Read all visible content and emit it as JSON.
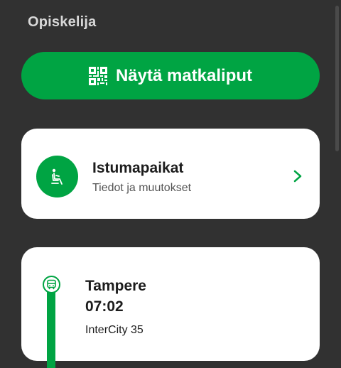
{
  "header": {
    "user_type": "Opiskelija"
  },
  "tickets_button": {
    "icon": "qr-code-icon",
    "label": "Näytä matkaliput"
  },
  "seats_card": {
    "icon": "seat-icon",
    "title": "Istumapaikat",
    "subtitle": "Tiedot ja muutokset",
    "chevron": "chevron-right-icon"
  },
  "trip_card": {
    "icon": "train-icon",
    "departure_station": "Tampere",
    "departure_time": "07:02",
    "train": "InterCity 35"
  },
  "colors": {
    "accent": "#00a443",
    "background": "#313131",
    "card": "#ffffff",
    "text": "#1c1c1c"
  }
}
